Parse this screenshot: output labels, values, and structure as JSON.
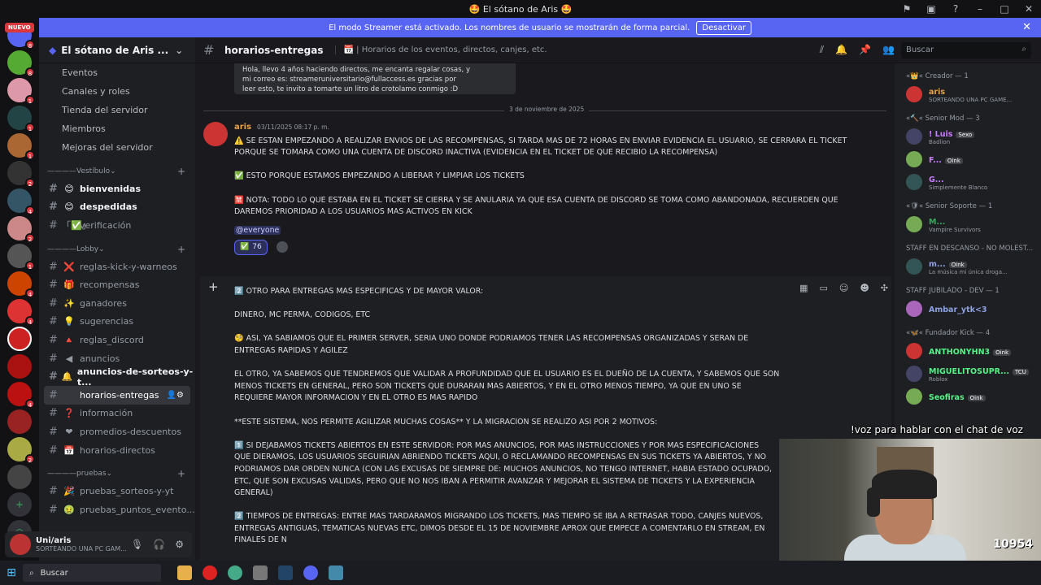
{
  "window": {
    "title": "🤩 El sótano de Aris 🤩"
  },
  "banner": {
    "text": "El modo Streamer está activado. Los nombres de usuario se mostrarán de forma parcial.",
    "button": "Desactivar"
  },
  "server_rail": {
    "new_label": "NUEVO"
  },
  "server": {
    "name": "El sótano de Aris ..."
  },
  "nav": [
    "Eventos",
    "Canales y roles",
    "Tienda del servidor",
    "Miembros",
    "Mejoras del servidor"
  ],
  "categories": {
    "vestibulo": "Vestíbulo",
    "lobby": "Lobby",
    "pruebas": "pruebas"
  },
  "channels_vestibulo": [
    {
      "emoji": "😊",
      "name": "bienvenidas"
    },
    {
      "emoji": "😊",
      "name": "despedidas"
    },
    {
      "emoji": "「✅」",
      "name": "verificación"
    }
  ],
  "channels_lobby": [
    {
      "emoji": "❌",
      "name": "reglas-kick-y-warneos"
    },
    {
      "emoji": "🎁",
      "name": "recompensas"
    },
    {
      "emoji": "✨",
      "name": "ganadores"
    },
    {
      "emoji": "💡",
      "name": "sugerencias"
    },
    {
      "emoji": "🔺",
      "name": "reglas_discord"
    },
    {
      "emoji": "◀",
      "name": "anuncios"
    },
    {
      "emoji": "🔔",
      "name": "anuncios-de-sorteos-y-t..."
    },
    {
      "emoji": "",
      "name": "horarios-entregas"
    },
    {
      "emoji": "❓",
      "name": "información"
    },
    {
      "emoji": "❤",
      "name": "promedios-descuentos"
    },
    {
      "emoji": "📅",
      "name": "horarios-directos"
    }
  ],
  "channels_pruebas": [
    {
      "emoji": "🎉",
      "name": "pruebas_sorteos-y-yt"
    },
    {
      "emoji": "🤢",
      "name": "pruebas_puntos_evento..."
    }
  ],
  "user": {
    "name": "Uni/aris",
    "status": "SORTEANDO UNA PC GAM..."
  },
  "header": {
    "channel": "horarios-entregas",
    "topic": "📆 | Horarios de los eventos, directos, canjes, etc.",
    "search_placeholder": "Buscar"
  },
  "embed_lines": [
    "Hola, llevo 4 años haciendo directos, me encanta regalar cosas, y",
    "mi correo es: streameruniversitario@fullaccess.es gracias por",
    "leer esto, te invito a tomarte un litro de crotolamo conmigo :D"
  ],
  "date_divider": "3 de noviembre de 2025",
  "message1": {
    "author": "aris",
    "time": "03/11/2025 08:17 p. m.",
    "lines": [
      "⚠️ SE ESTAN EMPEZANDO A REALIZAR ENVIOS DE LAS RECOMPENSAS, SI TARDA MAS DE 72 HORAS EN ENVIAR EVIDENCIA EL USUARIO, SE CERRARA EL TICKET",
      "PORQUE SE TOMARA COMO UNA CUENTA DE DISCORD INACTIVA (EVIDENCIA EN EL TICKET DE QUE RECIBIO LA RECOMPENSA)",
      "",
      "✅ ESTO PORQUE ESTAMOS EMPEZANDO A LIBERAR Y LIMPIAR LOS TICKETS",
      "",
      "🈲 NOTA: TODO LO QUE ESTABA EN EL TICKET SE CIERRA Y SE ANULARIA YA QUE ESA CUENTA DE DISCORD SE TOMA COMO ABANDONADA, RECUERDEN QUE",
      "DAREMOS PRIORIDAD A LOS USUARIOS MAS ACTIVOS EN KICK"
    ],
    "mention": "@everyone",
    "reaction": {
      "emoji": "✅",
      "count": "76"
    }
  },
  "message2": {
    "lines": [
      "2️⃣ OTRO PARA ENTREGAS MAS ESPECIFICAS Y DE MAYOR VALOR:",
      "",
      "DINERO, MC PERMA, CODIGOS, ETC",
      "",
      "🧐 ASI, YA SABIAMOS QUE EL PRIMER SERVER, SERIA UNO DONDE PODRIAMOS TENER LAS RECOMPENSAS ORGANIZADAS Y SERAN DE",
      "ENTREGAS RAPIDAS Y AGILEZ",
      "",
      "EL OTRO, YA SABEMOS QUE TENDREMOS QUE VALIDAR A PROFUNDIDAD QUE EL USUARIO ES EL DUEÑO DE LA CUENTA, Y SABEMOS QUE SON",
      "MENOS TICKETS EN GENERAL, PERO SON TICKETS QUE DURARAN MAS ABIERTOS, Y EN EL OTRO MENOS TIEMPO, YA QUE EN UNO SE",
      "REQUIERE MAYOR INFORMACION Y EN EL OTRO ES MAS RAPIDO",
      "",
      "**ESTE SISTEMA, NOS PERMITE AGILIZAR MUCHAS COSAS** Y LA MIGRACION SE REALIZO ASI POR 2 MOTIVOS:",
      "",
      "1️⃣ SI DEJABAMOS TICKETS ABIERTOS EN ESTE SERVIDOR: POR MAS ANUNCIOS, POR MAS INSTRUCCIONES Y POR MAS ESPECIFICACIONES",
      "QUE DIERAMOS, LOS USUARIOS SEGUIRIAN ABRIENDO TICKETS AQUI, O RECLAMANDO RECOMPENSAS EN SUS TICKETS YA ABIERTOS, Y NO",
      "PODRIAMOS DAR ORDEN NUNCA (CON LAS EXCUSAS DE SIEMPRE DE: MUCHOS ANUNCIOS, NO TENGO INTERNET, HABIA ESTADO OCUPADO,",
      "ETC, QUE SON EXCUSAS VALIDAS, PERO QUE NO NOS IBAN A PERMITIR AVANZAR Y MEJORAR EL SISTEMA DE TICKETS Y LA EXPERIENCIA",
      "GENERAL)",
      "",
      "2️⃣ TIEMPOS DE ENTREGAS: ENTRE MAS TARDARAMOS MIGRANDO LOS TICKETS, MAS TIEMPO SE IBA A RETRASAR TODO, CANJES NUEVOS,",
      "ENTREGAS ANTIGUAS, TEMATICAS NUEVAS ETC, DIMOS DESDE EL 15 DE NOVIEMBRE APROX QUE EMPECE A COMENTARLO EN STREAM, EN",
      "FINALES DE N"
    ]
  },
  "members": {
    "groups": [
      {
        "title": "«👑« Creador — 1",
        "items": [
          {
            "name": "aris",
            "sub": "SORTEANDO UNA PC GAME...",
            "tag": "",
            "color": "#e7a24a"
          }
        ]
      },
      {
        "title": "«🔨« Senior Mod — 3",
        "items": [
          {
            "name": "! Luis",
            "sub": "Badlion",
            "tag": "Sexo",
            "color": "#c77dff"
          },
          {
            "name": "F...",
            "sub": "",
            "tag": "Oink",
            "color": "#c77dff"
          },
          {
            "name": "G...",
            "sub": "Simplemente Blanco",
            "tag": "",
            "color": "#c77dff"
          }
        ]
      },
      {
        "title": "«🛡« Senior Soporte — 1",
        "items": [
          {
            "name": "M...",
            "sub": "Vampire Survivors",
            "tag": "",
            "color": "#3ba55d"
          }
        ]
      },
      {
        "title": "STAFF EN DESCANSO - NO MOLEST...",
        "items": [
          {
            "name": "m...",
            "sub": "La música mi única droga...",
            "tag": "Oink",
            "color": "#8ea1e1"
          }
        ]
      },
      {
        "title": "STAFF JUBILADO - DEV — 1",
        "items": [
          {
            "name": "Ambar_ytk<3",
            "sub": "",
            "tag": "",
            "color": "#8ea1e1"
          }
        ]
      },
      {
        "title": "«🦋« Fundador Kick — 4",
        "items": [
          {
            "name": "ANTHONYHN3",
            "sub": "",
            "tag": "Oink",
            "color": "#57f287"
          },
          {
            "name": "MIGUELITOSUPR...",
            "sub": "Roblox",
            "tag": "TCU",
            "color": "#57f287"
          },
          {
            "name": "Seofiras",
            "sub": "",
            "tag": "Oink",
            "color": "#57f287"
          }
        ]
      }
    ]
  },
  "overlay": {
    "label": "!voz para hablar con el chat de voz",
    "counter": "10954"
  },
  "taskbar": {
    "search": "Buscar"
  }
}
